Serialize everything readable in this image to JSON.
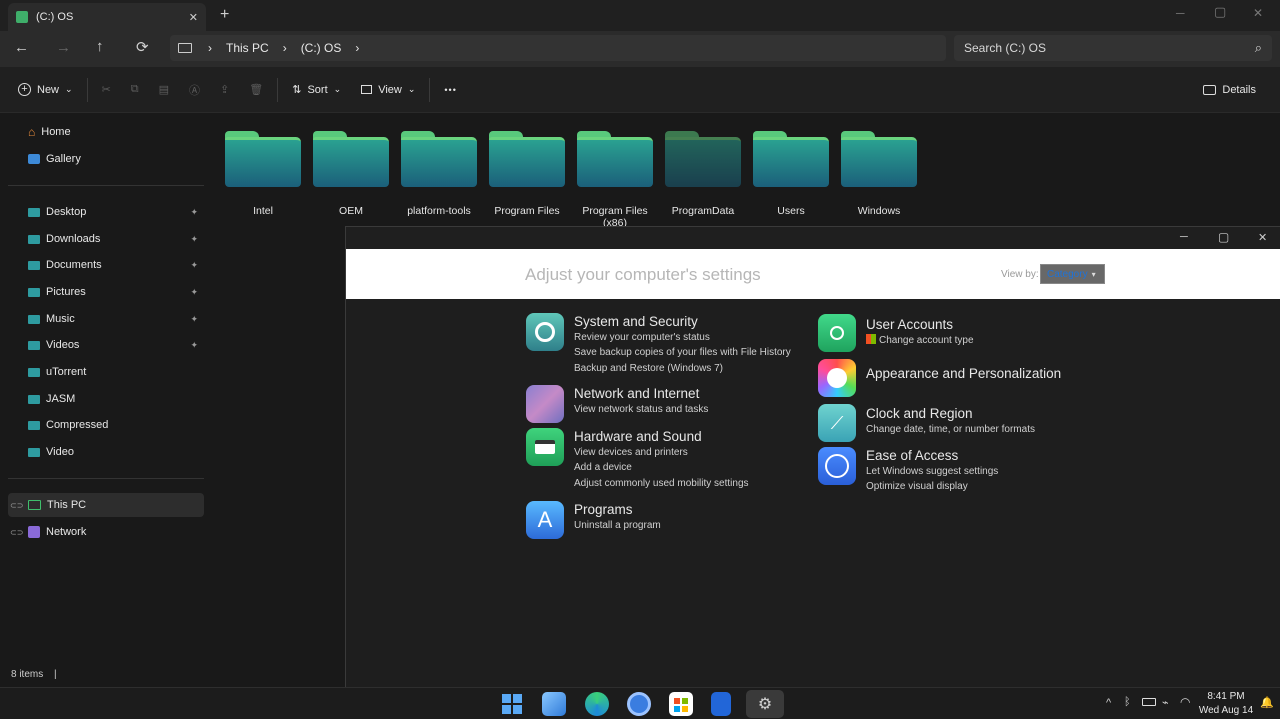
{
  "titlebar": {
    "tab_title": "(C:) OS",
    "new_tab": "+",
    "close_tab": "✕",
    "minimize": "─",
    "maximize": "▢",
    "close": "✕"
  },
  "nav": {
    "back": "←",
    "forward": "→",
    "up": "↑",
    "refresh": "⟳",
    "breadcrumb": [
      "This PC",
      "(C:) OS"
    ],
    "chevron": "›",
    "search_placeholder": "Search (C:) OS",
    "search_icon": "⌕"
  },
  "toolbar": {
    "new_label": "New",
    "sort_label": "Sort",
    "view_label": "View",
    "more_label": "•••",
    "details_label": "Details",
    "dropdown_caret": "⌄"
  },
  "sidebar": {
    "home": "Home",
    "gallery": "Gallery",
    "quick_access": [
      {
        "label": "Desktop",
        "pinned": true
      },
      {
        "label": "Downloads",
        "pinned": true
      },
      {
        "label": "Documents",
        "pinned": true
      },
      {
        "label": "Pictures",
        "pinned": true
      },
      {
        "label": "Music",
        "pinned": true
      },
      {
        "label": "Videos",
        "pinned": true
      },
      {
        "label": "uTorrent",
        "pinned": false
      },
      {
        "label": "JASM",
        "pinned": false
      },
      {
        "label": "Compressed",
        "pinned": false
      },
      {
        "label": "Video",
        "pinned": false
      }
    ],
    "pin_glyph": "📌",
    "this_pc": "This PC",
    "network": "Network"
  },
  "folders": [
    {
      "name": "Intel"
    },
    {
      "name": "OEM"
    },
    {
      "name": "platform-tools"
    },
    {
      "name": "Program Files"
    },
    {
      "name": "Program Files (x86)"
    },
    {
      "name": "ProgramData"
    },
    {
      "name": "Users"
    },
    {
      "name": "Windows"
    }
  ],
  "status": {
    "items": "8 items",
    "sep": "|"
  },
  "control_panel": {
    "heading": "Adjust your computer's settings",
    "view_by_label": "View by:",
    "view_by_value": "Category",
    "categories_left": [
      {
        "title": "System and Security",
        "links": [
          "Review your computer's status",
          "Save backup copies of your files with File History",
          "Backup and Restore (Windows 7)"
        ]
      },
      {
        "title": "Network and Internet",
        "links": [
          "View network status and tasks"
        ]
      },
      {
        "title": "Hardware and Sound",
        "links": [
          "View devices and printers",
          "Add a device",
          "Adjust commonly used mobility settings"
        ]
      },
      {
        "title": "Programs",
        "links": [
          "Uninstall a program"
        ]
      }
    ],
    "categories_right": [
      {
        "title": "User Accounts",
        "links": [
          "Change account type"
        ]
      },
      {
        "title": "Appearance and Personalization",
        "links": []
      },
      {
        "title": "Clock and Region",
        "links": [
          "Change date, time, or number formats"
        ]
      },
      {
        "title": "Ease of Access",
        "links": [
          "Let Windows suggest settings",
          "Optimize visual display"
        ]
      }
    ]
  },
  "taskbar": {
    "time": "8:41 PM",
    "date": "Wed Aug 14",
    "tray_chevron": "^"
  },
  "colors": {
    "accent": "#2aa191",
    "folder_tab": "#59c97c"
  }
}
